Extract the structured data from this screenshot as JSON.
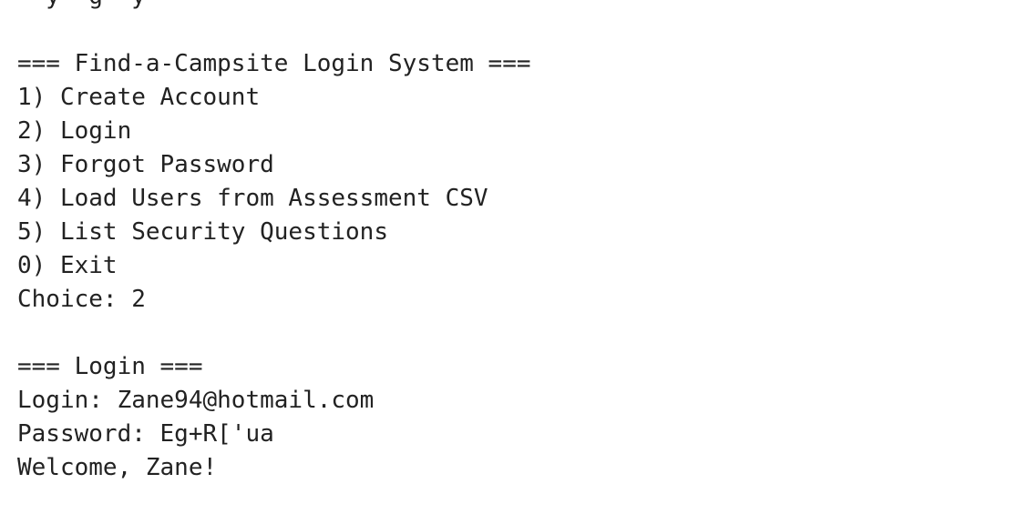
{
  "console": {
    "top_fragment": "  y  g  y",
    "main_menu": {
      "header": "=== Find-a-Campsite Login System ===",
      "options": [
        "1) Create Account",
        "2) Login",
        "3) Forgot Password",
        "4) Load Users from Assessment CSV",
        "5) List Security Questions",
        "0) Exit"
      ],
      "choice_line": "Choice: 2"
    },
    "login_section": {
      "header": "=== Login ===",
      "login_line": "Login: Zane94@hotmail.com",
      "password_line": "Password: Eg+R['ua",
      "welcome_line": "Welcome, Zane!"
    }
  }
}
